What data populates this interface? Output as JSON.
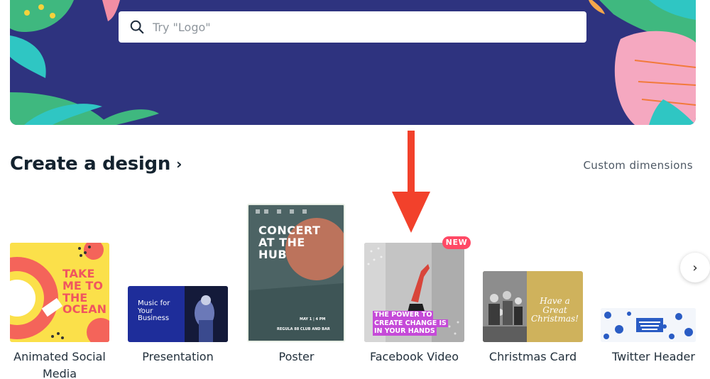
{
  "search": {
    "placeholder": "Try \"Logo\"",
    "icon": "search-icon"
  },
  "section": {
    "title": "Create a design",
    "chevron": "›",
    "custom_dimensions": "Custom dimensions"
  },
  "cards": [
    {
      "label": "Animated Social Media",
      "label_line1": "Animated Social",
      "label_line2": "Media",
      "thumb_text": [
        "TAKE",
        "ME TO",
        "THE",
        "OCEAN"
      ]
    },
    {
      "label": "Presentation",
      "thumb_text": [
        "Music for",
        "Your",
        "Business"
      ]
    },
    {
      "label": "Poster",
      "thumb_text": [
        "CONCERT",
        "AT THE",
        "HUB"
      ],
      "thumb_date": "MAY 1 | 4 PM",
      "thumb_venue": "REGULA 88 CLUB AND BAR"
    },
    {
      "label": "Facebook Video",
      "badge": "NEW",
      "thumb_text": [
        "THE POWER TO",
        "CREATE CHANGE IS",
        "IN YOUR HANDS"
      ]
    },
    {
      "label": "Christmas Card",
      "thumb_text": [
        "Have a",
        "Great",
        "Christmas!"
      ]
    },
    {
      "label": "Twitter Header"
    }
  ],
  "next_button": {
    "glyph": "›",
    "icon": "chevron-right-icon"
  },
  "colors": {
    "hero_bg": "#2e337f",
    "badge_new": "#ff4965",
    "arrow": "#f2412b"
  }
}
